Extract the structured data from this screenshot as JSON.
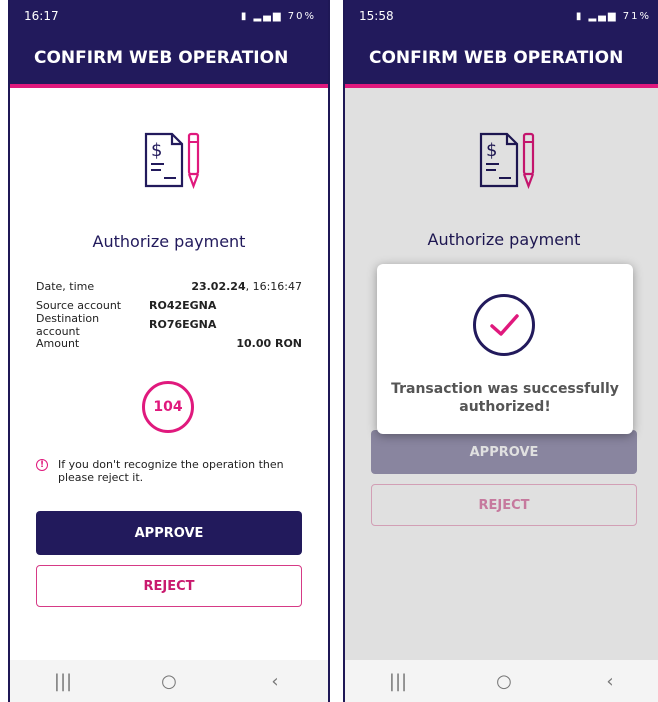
{
  "screen1": {
    "status_time": "16:17",
    "status_battery": "70%",
    "header_title": "CONFIRM WEB OPERATION",
    "title": "Authorize payment",
    "rows": [
      {
        "label": "Date, time",
        "value_bold": "23.02.24",
        "value_rest": ", 16:16:47"
      },
      {
        "label": "Source account",
        "value": "RO42EGNA"
      },
      {
        "label": "Destination account",
        "value": "RO76EGNA"
      },
      {
        "label": "Amount",
        "value_right": "10.00 RON"
      }
    ],
    "timer": "104",
    "warning": "If you don't recognize the operation then please reject it.",
    "approve_label": "APPROVE",
    "reject_label": "REJECT"
  },
  "screen2": {
    "status_time": "15:58",
    "status_battery": "71%",
    "header_title": "CONFIRM WEB OPERATION",
    "title": "Authorize payment",
    "modal_text": "Transaction was successfully authorized!",
    "approve_label": "APPROVE",
    "reject_label": "REJECT"
  },
  "nav": {
    "recents": "|||",
    "home": "○",
    "back": "‹"
  },
  "colors": {
    "primary": "#221a5c",
    "accent": "#e0197d"
  }
}
